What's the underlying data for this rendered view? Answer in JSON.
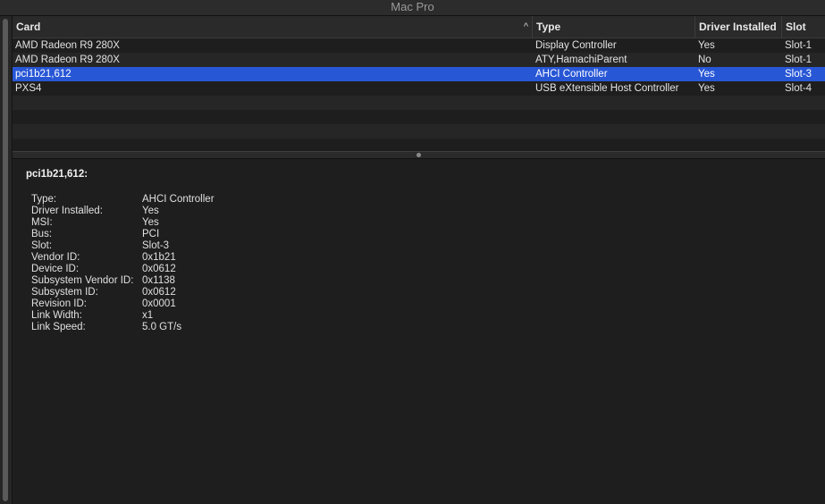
{
  "window": {
    "title": "Mac Pro"
  },
  "table": {
    "columns": {
      "card": "Card",
      "type": "Type",
      "driver": "Driver Installed",
      "slot": "Slot"
    },
    "sort_indicator": "^",
    "rows": [
      {
        "card": "AMD Radeon R9 280X",
        "type": "Display Controller",
        "driver": "Yes",
        "slot": "Slot-1"
      },
      {
        "card": "AMD Radeon R9 280X",
        "type": "ATY,HamachiParent",
        "driver": "No",
        "slot": "Slot-1"
      },
      {
        "card": "pci1b21,612",
        "type": "AHCI Controller",
        "driver": "Yes",
        "slot": "Slot-3"
      },
      {
        "card": "PXS4",
        "type": "USB eXtensible Host Controller",
        "driver": "Yes",
        "slot": "Slot-4"
      }
    ],
    "selected_row": 2
  },
  "detail": {
    "title": "pci1b21,612:",
    "props": [
      {
        "key": "Type:",
        "value": "AHCI Controller"
      },
      {
        "key": "Driver Installed:",
        "value": "Yes"
      },
      {
        "key": "MSI:",
        "value": "Yes"
      },
      {
        "key": "Bus:",
        "value": "PCI"
      },
      {
        "key": "Slot:",
        "value": "Slot-3"
      },
      {
        "key": "Vendor ID:",
        "value": "0x1b21"
      },
      {
        "key": "Device ID:",
        "value": "0x0612"
      },
      {
        "key": "Subsystem Vendor ID:",
        "value": "0x1138"
      },
      {
        "key": "Subsystem ID:",
        "value": "0x0612"
      },
      {
        "key": "Revision ID:",
        "value": "0x0001"
      },
      {
        "key": "Link Width:",
        "value": "x1"
      },
      {
        "key": "Link Speed:",
        "value": "5.0 GT/s"
      }
    ]
  },
  "colors": {
    "selection": "#2857d6",
    "background": "#1e1e1e",
    "header": "#2a2a2a"
  }
}
